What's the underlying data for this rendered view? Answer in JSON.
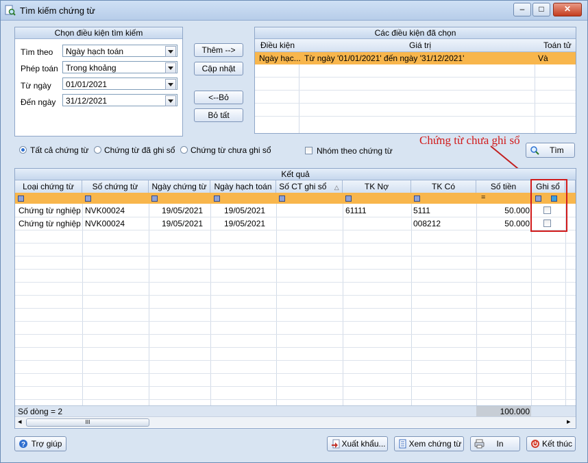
{
  "window": {
    "title": "Tìm kiếm chứng từ",
    "controls": {
      "minimize": "–",
      "maximize": "□",
      "close": "✕"
    }
  },
  "criteria_panel": {
    "title": "Chọn điều kiện tìm kiếm",
    "fields": [
      {
        "label": "Tìm theo",
        "value": "Ngày hạch toán"
      },
      {
        "label": "Phép toán",
        "value": "Trong khoảng"
      },
      {
        "label": "Từ ngày",
        "value": "01/01/2021"
      },
      {
        "label": "Đến ngày",
        "value": "31/12/2021"
      }
    ]
  },
  "middle_buttons": {
    "add": "Thêm -->",
    "update": "Cập nhật",
    "remove": "<--Bỏ",
    "remove_all": "Bỏ tất"
  },
  "selected_panel": {
    "title": "Các điều kiện đã chọn",
    "headers": [
      "Điều kiện",
      "Giá trị",
      "Toán tử"
    ],
    "rows": [
      {
        "condition": "Ngày hạc...",
        "value": "Từ ngày '01/01/2021' đến ngày '31/12/2021'",
        "operator": "Và"
      }
    ]
  },
  "filter_options": {
    "all": "Tất cả chứng từ",
    "posted": "Chứng từ đã ghi sổ",
    "unposted": "Chứng từ chưa ghi sổ",
    "group_by": "Nhóm theo chứng từ",
    "selected": "all"
  },
  "search_button": "Tìm",
  "annotation": "Chứng từ chưa ghi sổ",
  "results": {
    "title": "Kết quả",
    "columns": [
      "Loại chứng từ",
      "Số chứng từ",
      "Ngày chứng từ",
      "Ngày hạch toán",
      "Số CT ghi sổ",
      "TK Nợ",
      "TK Có",
      "Số tiền",
      "Ghi sổ"
    ],
    "sort_indicator": "△",
    "rows": [
      {
        "type": "Chứng từ nghiệp...",
        "number": "NVK00024",
        "doc_date": "19/05/2021",
        "post_date": "19/05/2021",
        "ledger_no": "",
        "debit": "61111",
        "credit": "5111",
        "amount": "50.000",
        "posted": false
      },
      {
        "type": "Chứng từ nghiệp...",
        "number": "NVK00024",
        "doc_date": "19/05/2021",
        "post_date": "19/05/2021",
        "ledger_no": "",
        "debit": "",
        "credit": "008212",
        "amount": "50.000",
        "posted": false
      }
    ],
    "row_count": "Số dòng = 2",
    "total": "100.000",
    "filter_equals": "="
  },
  "scrollbar": {
    "left": "◂",
    "right": "▸",
    "thumb": "III"
  },
  "bottom_buttons": {
    "help": "Trợ giúp",
    "export": "Xuất khẩu...",
    "view": "Xem chứng từ",
    "print": "In",
    "close": "Kết thúc"
  },
  "colors": {
    "highlight": "#f8b64c",
    "annotation": "#d11a1a",
    "accent": "#2b6fd1"
  }
}
